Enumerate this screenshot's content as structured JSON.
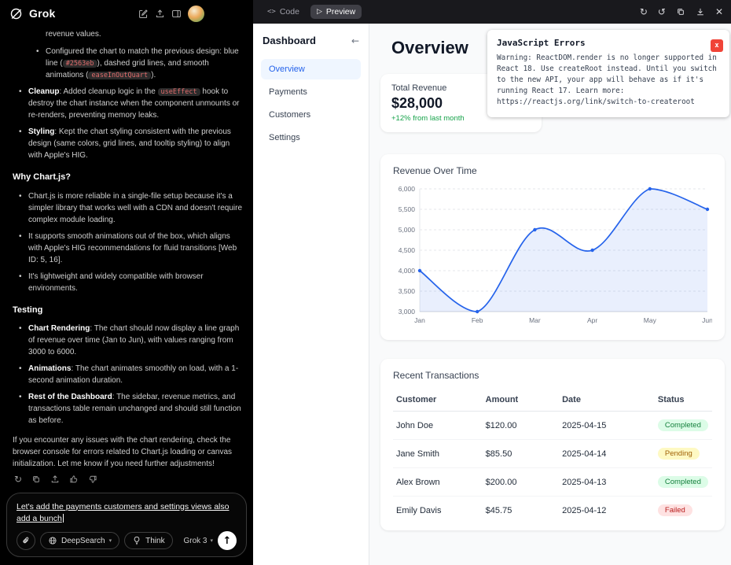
{
  "colors": {
    "accent": "#2563eb",
    "positive": "#16a34a",
    "error_red": "#f04438",
    "badge_completed_bg": "#dcfce7",
    "badge_completed_fg": "#15803d",
    "badge_pending_bg": "#fef9c3",
    "badge_pending_fg": "#a16207",
    "badge_failed_bg": "#fee2e2",
    "badge_failed_fg": "#b91c1c"
  },
  "icons": {
    "code_glyph": "<>",
    "play_glyph": "▷",
    "refresh": "↻",
    "history": "↺",
    "close": "✕",
    "send": "↑",
    "collapse_arrow": "←",
    "chevron_down": "▾",
    "regenerate": "↻"
  },
  "left_panel": {
    "header": {
      "app_name": "Grok"
    },
    "chat": {
      "blocks": [
        {
          "type": "clipped",
          "text": "revenue values."
        },
        {
          "type": "bullet",
          "indent": 2,
          "segments": [
            {
              "t": "Configured the chart to match the previous design: blue line ("
            },
            {
              "t": "#2563eb",
              "s": "code"
            },
            {
              "t": "), dashed grid lines, and smooth animations ("
            },
            {
              "t": "easeInOutQuart",
              "s": "code"
            },
            {
              "t": ")."
            }
          ]
        },
        {
          "type": "bullet",
          "indent": 1,
          "segments": [
            {
              "t": "Cleanup",
              "s": "bold"
            },
            {
              "t": ": Added cleanup logic in the "
            },
            {
              "t": "useEffect",
              "s": "code"
            },
            {
              "t": " hook to destroy the chart instance when the component unmounts or re-renders, preventing memory leaks."
            }
          ]
        },
        {
          "type": "bullet",
          "indent": 1,
          "segments": [
            {
              "t": "Styling",
              "s": "bold"
            },
            {
              "t": ": Kept the chart styling consistent with the previous design (same colors, grid lines, and tooltip styling) to align with Apple's HIG."
            }
          ]
        },
        {
          "type": "heading",
          "text": "Why Chart.js?"
        },
        {
          "type": "bullet",
          "indent": 1,
          "segments": [
            {
              "t": "Chart.js is more reliable in a single-file setup because it's a simpler library that works well with a CDN and doesn't require complex module loading."
            }
          ]
        },
        {
          "type": "bullet",
          "indent": 1,
          "segments": [
            {
              "t": "It supports smooth animations out of the box, which aligns with Apple's HIG recommendations for fluid transitions [Web ID: 5, 16]."
            }
          ]
        },
        {
          "type": "bullet",
          "indent": 1,
          "segments": [
            {
              "t": "It's lightweight and widely compatible with browser environments."
            }
          ]
        },
        {
          "type": "heading",
          "text": "Testing"
        },
        {
          "type": "bullet",
          "indent": 1,
          "segments": [
            {
              "t": "Chart Rendering",
              "s": "bold"
            },
            {
              "t": ": The chart should now display a line graph of revenue over time (Jan to Jun), with values ranging from 3000 to 6000."
            }
          ]
        },
        {
          "type": "bullet",
          "indent": 1,
          "segments": [
            {
              "t": "Animations",
              "s": "bold"
            },
            {
              "t": ": The chart animates smoothly on load, with a 1-second animation duration."
            }
          ]
        },
        {
          "type": "bullet",
          "indent": 1,
          "segments": [
            {
              "t": "Rest of the Dashboard",
              "s": "bold"
            },
            {
              "t": ": The sidebar, revenue metrics, and transactions table remain unchanged and should still function as before."
            }
          ]
        },
        {
          "type": "paragraph",
          "text": "If you encounter any issues with the chart rendering, check the browser console for errors related to Chart.js loading or canvas initialization. Let me know if you need further adjustments!"
        }
      ]
    },
    "composer": {
      "text": "Let's add the payments customers and settings views also add a bunch",
      "deepsearch_label": "DeepSearch",
      "think_label": "Think",
      "model_label": "Grok 3"
    }
  },
  "workbench": {
    "code_tab": "Code",
    "preview_tab": "Preview"
  },
  "preview": {
    "sidebar": {
      "title": "Dashboard",
      "items": [
        {
          "label": "Overview",
          "active": true
        },
        {
          "label": "Payments",
          "active": false
        },
        {
          "label": "Customers",
          "active": false
        },
        {
          "label": "Settings",
          "active": false
        }
      ]
    },
    "main": {
      "title": "Overview",
      "metric_card": {
        "label": "Total Revenue",
        "value": "$28,000",
        "delta": "+12% from last month"
      },
      "error_panel": {
        "title": "JavaScript Errors",
        "close_label": "x",
        "message": "Warning: ReactDOM.render is no longer supported in React 18. Use createRoot instead. Until you switch to the new API, your app will behave as if it's running React 17. Learn more: https://reactjs.org/link/switch-to-createroot"
      },
      "transactions": {
        "title": "Recent Transactions",
        "columns": [
          "Customer",
          "Amount",
          "Date",
          "Status"
        ],
        "rows": [
          {
            "customer": "John Doe",
            "amount": "$120.00",
            "date": "2025-04-15",
            "status": "Completed"
          },
          {
            "customer": "Jane Smith",
            "amount": "$85.50",
            "date": "2025-04-14",
            "status": "Pending"
          },
          {
            "customer": "Alex Brown",
            "amount": "$200.00",
            "date": "2025-04-13",
            "status": "Completed"
          },
          {
            "customer": "Emily Davis",
            "amount": "$45.75",
            "date": "2025-04-12",
            "status": "Failed"
          }
        ],
        "status_colors": {
          "Completed": {
            "bg": "#dcfce7",
            "fg": "#15803d"
          },
          "Pending": {
            "bg": "#fef9c3",
            "fg": "#a16207"
          },
          "Failed": {
            "bg": "#fee2e2",
            "fg": "#b91c1c"
          }
        }
      }
    }
  },
  "chart_data": {
    "type": "line",
    "title": "Revenue Over Time",
    "x": [
      "Jan",
      "Feb",
      "Mar",
      "Apr",
      "May",
      "Jun"
    ],
    "series": [
      {
        "name": "Revenue",
        "values": [
          4000,
          3000,
          5000,
          4500,
          6000,
          5500
        ]
      }
    ],
    "ylim": [
      3000,
      6000
    ],
    "yticks": [
      3000,
      3500,
      4000,
      4500,
      5000,
      5500,
      6000
    ],
    "grid": true,
    "grid_style": "dashed",
    "legend": false,
    "line_color": "#2563eb",
    "fill_color": "rgba(37,99,235,0.10)"
  }
}
